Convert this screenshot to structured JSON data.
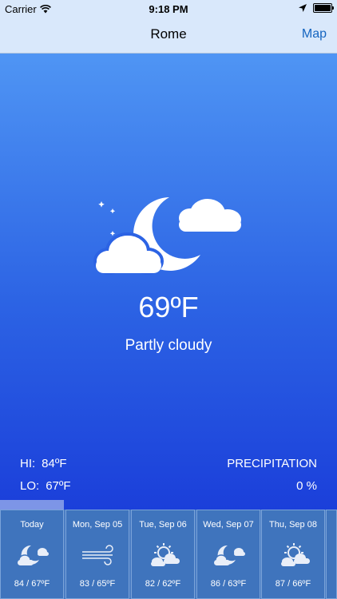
{
  "status_bar": {
    "carrier": "Carrier",
    "time": "9:18 PM"
  },
  "nav": {
    "title": "Rome",
    "map_button": "Map"
  },
  "current": {
    "temperature": "69ºF",
    "condition": "Partly cloudy",
    "icon": "moon-cloud-icon",
    "hi_label": "HI:",
    "hi_value": "84ºF",
    "lo_label": "LO:",
    "lo_value": "67ºF",
    "precip_label": "PRECIPITATION",
    "precip_value": "0 %"
  },
  "forecast": [
    {
      "day": "Today",
      "temps": "84 / 67ºF",
      "icon": "moon-cloud-icon"
    },
    {
      "day": "Mon, Sep 05",
      "temps": "83 / 65ºF",
      "icon": "wind-icon"
    },
    {
      "day": "Tue, Sep 06",
      "temps": "82 / 62ºF",
      "icon": "sun-cloud-icon"
    },
    {
      "day": "Wed, Sep 07",
      "temps": "86 / 63ºF",
      "icon": "moon-cloud-icon"
    },
    {
      "day": "Thu, Sep 08",
      "temps": "87 / 66ºF",
      "icon": "sun-cloud-icon"
    }
  ],
  "colors": {
    "gradient_top": "#4f95f4",
    "gradient_bottom": "#1b3fda",
    "nav_background": "#d9e8fb",
    "link": "#1565c0",
    "forecast_cell": "#3f74bd"
  }
}
